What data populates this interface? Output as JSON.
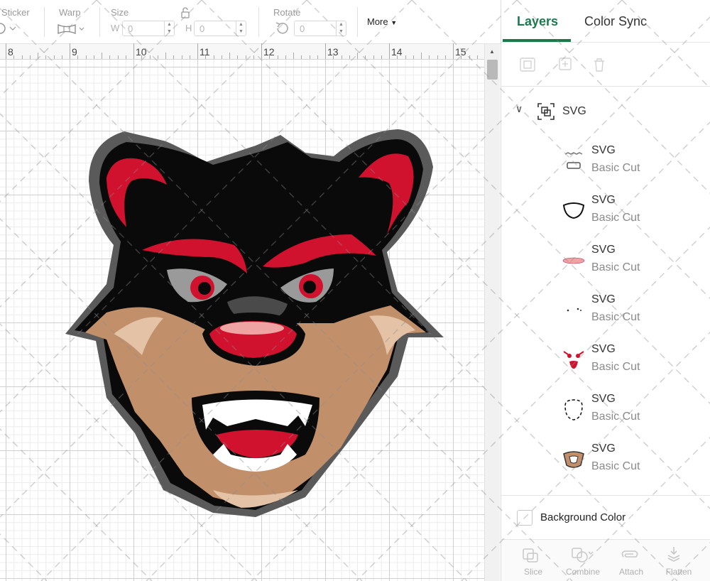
{
  "toolbar": {
    "sticker_label": "Sticker",
    "warp_label": "Warp",
    "size_label": "Size",
    "width_short": "W",
    "width_value": "0",
    "height_short": "H",
    "height_value": "0",
    "rotate_label": "Rotate",
    "rotate_value": "0",
    "more_label": "More"
  },
  "ruler": {
    "ticks": [
      "8",
      "9",
      "10",
      "11",
      "12",
      "13",
      "14",
      "15"
    ]
  },
  "panel": {
    "tabs": [
      {
        "label": "Layers",
        "active": true
      },
      {
        "label": "Color Sync",
        "active": false
      }
    ],
    "group": {
      "name": "SVG"
    },
    "layers": [
      {
        "name": "SVG",
        "type": "Basic Cut",
        "thumb": "teeth"
      },
      {
        "name": "SVG",
        "type": "Basic Cut",
        "thumb": "mouth-outline"
      },
      {
        "name": "SVG",
        "type": "Basic Cut",
        "thumb": "nose-highlight"
      },
      {
        "name": "SVG",
        "type": "Basic Cut",
        "thumb": "dots"
      },
      {
        "name": "SVG",
        "type": "Basic Cut",
        "thumb": "red-details"
      },
      {
        "name": "SVG",
        "type": "Basic Cut",
        "thumb": "face-outline"
      },
      {
        "name": "SVG",
        "type": "Basic Cut",
        "thumb": "muzzle"
      }
    ],
    "background_color_label": "Background Color",
    "bottom_actions": [
      {
        "label": "Slice",
        "icon": "slice-icon"
      },
      {
        "label": "Combine",
        "icon": "combine-icon"
      },
      {
        "label": "Attach",
        "icon": "attach-icon"
      },
      {
        "label": "Flatten",
        "icon": "flatten-icon"
      }
    ]
  },
  "colors": {
    "accent": "#1a7a4c",
    "mascot_black": "#0a0a0a",
    "mascot_red": "#d0122e",
    "mascot_tan": "#c1906b",
    "mascot_gray": "#5a5a5a"
  }
}
